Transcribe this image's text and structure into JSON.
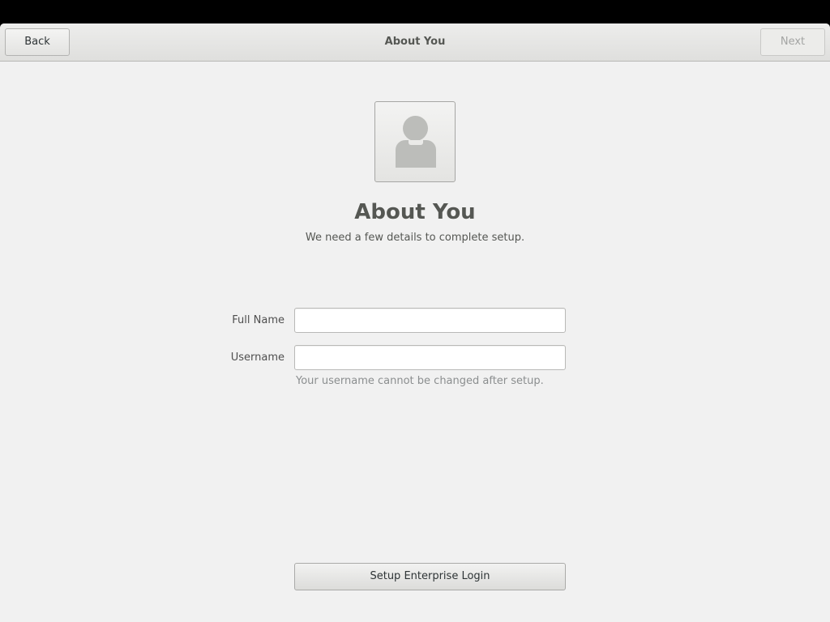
{
  "header": {
    "back_label": "Back",
    "title": "About You",
    "next_label": "Next"
  },
  "avatar": {
    "icon": "avatar-placeholder-icon"
  },
  "main": {
    "heading": "About You",
    "subtitle": "We need a few details to complete setup."
  },
  "form": {
    "full_name": {
      "label": "Full Name",
      "value": "",
      "placeholder": ""
    },
    "username": {
      "label": "Username",
      "value": "",
      "placeholder": "",
      "hint": "Your username cannot be changed after setup."
    }
  },
  "footer": {
    "enterprise_label": "Setup Enterprise Login"
  },
  "colors": {
    "background": "#f1f1f1",
    "headerbar": "#dfdfdd",
    "text": "#555753",
    "hint": "#8b8e8f",
    "disabled_text": "#a3a4a3"
  }
}
